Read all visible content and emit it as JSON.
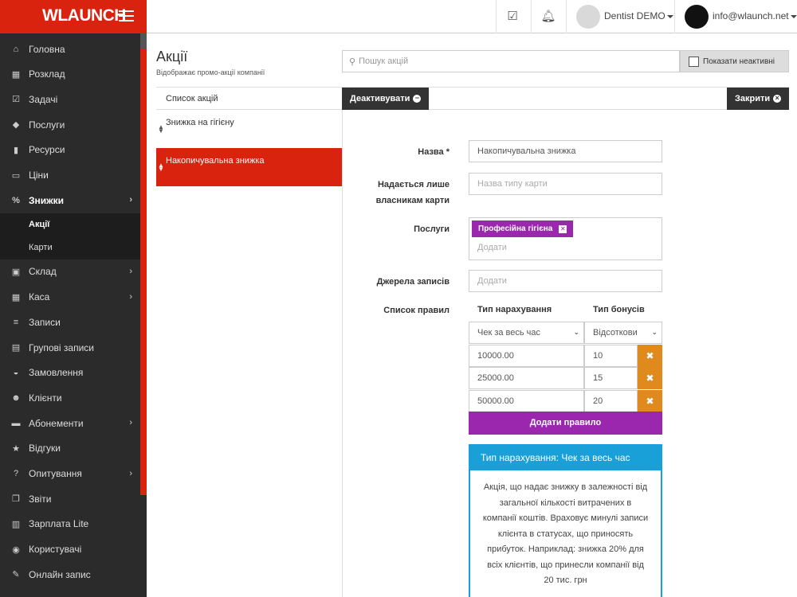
{
  "brand": {
    "logo": "WLAUNCH"
  },
  "topbar": {
    "clinic": "Dentist DEMO",
    "user_email": "info@wlaunch.net"
  },
  "sidebar": {
    "items": [
      {
        "label": "Головна",
        "icon": "home-icon",
        "glyph": "⌂"
      },
      {
        "label": "Розклад",
        "icon": "calendar-icon",
        "glyph": "▦"
      },
      {
        "label": "Задачі",
        "icon": "checkbox-icon",
        "glyph": "☑"
      },
      {
        "label": "Послуги",
        "icon": "tag-icon",
        "glyph": "◆"
      },
      {
        "label": "Ресурси",
        "icon": "resource-icon",
        "glyph": "▮"
      },
      {
        "label": "Ціни",
        "icon": "money-icon",
        "glyph": "▭"
      },
      {
        "label": "Знижки",
        "icon": "percent-icon",
        "glyph": "%"
      },
      {
        "label": "Склад",
        "icon": "cubes-icon",
        "glyph": "▣"
      },
      {
        "label": "Каса",
        "icon": "calculator-icon",
        "glyph": "▦"
      },
      {
        "label": "Записи",
        "icon": "list-icon",
        "glyph": "≡"
      },
      {
        "label": "Групові записи",
        "icon": "calendar-plus-icon",
        "glyph": "▤"
      },
      {
        "label": "Замовлення",
        "icon": "basket-icon",
        "glyph": "◒"
      },
      {
        "label": "Клієнти",
        "icon": "users-icon",
        "glyph": "☻"
      },
      {
        "label": "Абонементи",
        "icon": "id-card-icon",
        "glyph": "▬"
      },
      {
        "label": "Відгуки",
        "icon": "star-icon",
        "glyph": "★"
      },
      {
        "label": "Опитування",
        "icon": "question-icon",
        "glyph": "?"
      },
      {
        "label": "Звіти",
        "icon": "copy-icon",
        "glyph": "❐"
      },
      {
        "label": "Зарплата Lite",
        "icon": "book-icon",
        "glyph": "▥"
      },
      {
        "label": "Користувачі",
        "icon": "user-circle-icon",
        "glyph": "◉"
      },
      {
        "label": "Онлайн запис",
        "icon": "edit-icon",
        "glyph": "✎"
      }
    ],
    "sub_items": [
      "Акції",
      "Карти"
    ]
  },
  "page": {
    "title": "Акції",
    "subtitle": "Відображає промо-акції компанії",
    "search_placeholder": "Пошук акцій",
    "show_inactive": "Показати неактивні"
  },
  "list": {
    "header": "Список акцій",
    "items": [
      "Знижка на гігієну",
      "Накопичувальна знижка"
    ]
  },
  "toolbar": {
    "deactivate": "Деактивувати",
    "close": "Закрити"
  },
  "form": {
    "name_label": "Назва *",
    "name_value": "Накопичувальна знижка",
    "card_label_1": "Надається лише",
    "card_label_2": "власникам карти",
    "card_placeholder": "Назва типу карти",
    "services_label": "Послуги",
    "service_tag": "Професійна гігієна",
    "add_placeholder": "Додати",
    "sources_label": "Джерела записів",
    "rules_label": "Список правил",
    "col_accrual": "Тип нарахування",
    "col_bonus": "Тип бонусів",
    "accrual_select": "Чек за весь час",
    "bonus_select": "Відсоткови",
    "rules": [
      {
        "threshold": "10000.00",
        "bonus": "10"
      },
      {
        "threshold": "25000.00",
        "bonus": "15"
      },
      {
        "threshold": "50000.00",
        "bonus": "20"
      }
    ],
    "add_rule": "Додати правило"
  },
  "info": {
    "title": "Тип нарахування: Чек за весь час",
    "lines": [
      "Акція, що надає знижку в залежності від",
      "загальної кількості витрачених в",
      "компанії коштів. Враховує минулі записи",
      "клієнта в статусах, що приносять",
      "прибуток. Наприклад: знижка 20% для",
      "всіх клієнтів, що принесли компанії від",
      "20 тис. грн"
    ]
  },
  "colors": {
    "brand_red": "#d9230f",
    "sidebar_bg": "#2b2b2b",
    "purple": "#9b27af",
    "orange": "#e08a1e",
    "info_blue": "#19a0d9"
  }
}
